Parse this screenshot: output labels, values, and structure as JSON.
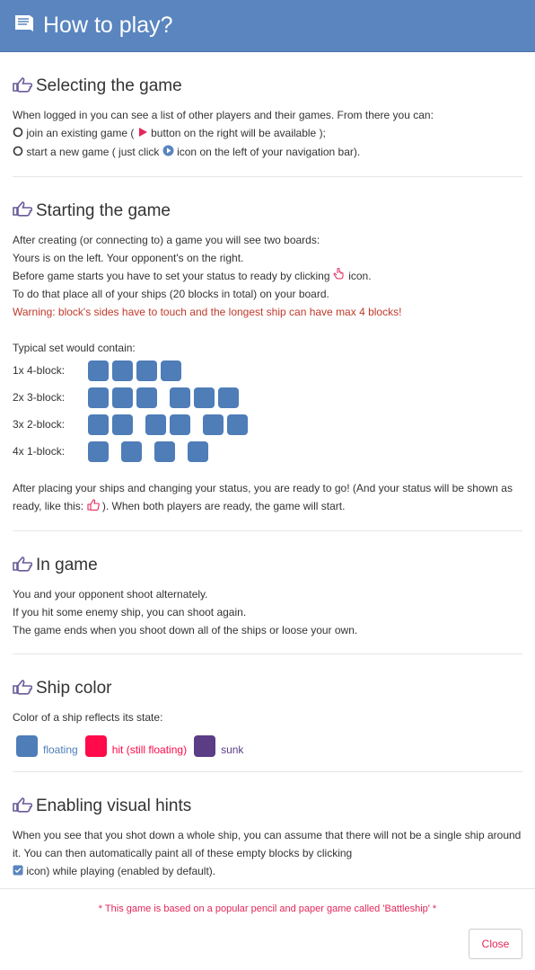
{
  "header": {
    "title": "How to play?"
  },
  "sections": {
    "selecting": {
      "title": "Selecting the game",
      "intro": "When logged in you can see a list of other players and their games. From there you can:",
      "opt1_a": "join an existing game (",
      "opt1_b": "button on the right will be available );",
      "opt2_a": "start a new game ( just click",
      "opt2_b": "icon on the left of your navigation bar)."
    },
    "starting": {
      "title": "Starting the game",
      "l1": "After creating (or connecting to) a game you will see two boards:",
      "l2": "Yours is on the left. Your opponent's on the right.",
      "l3a": "Before game starts you have to set your status to ready by clicking",
      "l3b": "icon.",
      "l4": "To do that place all of your ships (20 blocks in total) on your board.",
      "warning": "Warning: block's sides have to touch and the longest ship can have max 4 blocks!",
      "typical": "Typical set would contain:",
      "ships": [
        {
          "label": "1x 4-block:"
        },
        {
          "label": "2x 3-block:"
        },
        {
          "label": "3x 2-block:"
        },
        {
          "label": "4x 1-block:"
        }
      ],
      "after_a": "After placing your ships and changing your status, you are ready to go! (And your status will be shown as ready, like this:",
      "after_b": "). When both players are ready, the game will start."
    },
    "ingame": {
      "title": "In game",
      "l1": "You and your opponent shoot alternately.",
      "l2": "If you hit some enemy ship, you can shoot again.",
      "l3": "The game ends when you shoot down all of the ships or loose your own."
    },
    "color": {
      "title": "Ship color",
      "intro": "Color of a ship reflects its state:",
      "states": [
        {
          "label": "floating",
          "color": "#4e7db8"
        },
        {
          "label": "hit (still floating)",
          "color": "#ff0a4a"
        },
        {
          "label": "sunk",
          "color": "#5b3d86"
        }
      ]
    },
    "hints": {
      "title": "Enabling visual hints",
      "l1": "When you see that you shot down a whole ship, you can assume that there will not be a single ship around it. You can then automatically paint all of these empty blocks by clicking",
      "l2": "icon) while playing (enabled by default)."
    }
  },
  "footer": {
    "note": "* This game is based on a popular pencil and paper game called 'Battleship' *",
    "close_label": "Close"
  },
  "colors": {
    "header": "#5a85bf",
    "ship": "#4e7db8",
    "hit": "#ff0a4a",
    "sunk": "#5b3d86",
    "accent": "#e2275a"
  }
}
